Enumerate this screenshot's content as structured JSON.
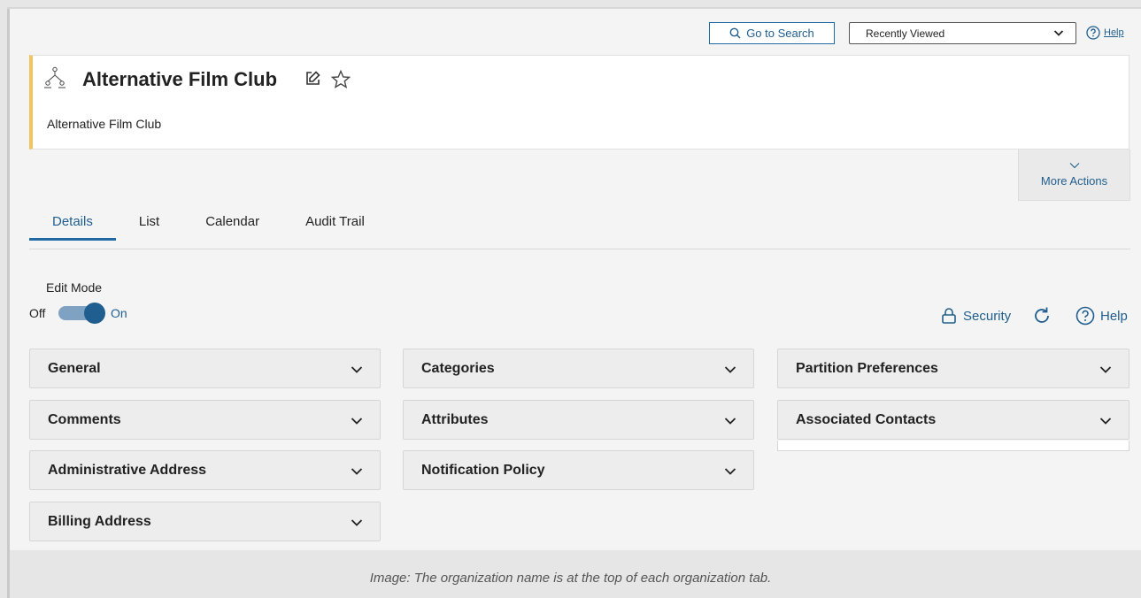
{
  "topbar": {
    "search_label": "Go to Search",
    "recent_value": "Recently Viewed",
    "help_label": "Help"
  },
  "header": {
    "title": "Alternative Film Club",
    "subtitle": "Alternative Film Club",
    "accent_color": "#f0c560"
  },
  "more_actions_label": "More Actions",
  "tabs": [
    {
      "label": "Details",
      "active": true
    },
    {
      "label": "List"
    },
    {
      "label": "Calendar"
    },
    {
      "label": "Audit Trail"
    }
  ],
  "edit_mode": {
    "label": "Edit Mode",
    "off_label": "Off",
    "on_label": "On",
    "state": "on"
  },
  "actions": {
    "security_label": "Security",
    "help_label": "Help"
  },
  "panels": {
    "col1": [
      "General",
      "Comments",
      "Administrative Address",
      "Billing Address"
    ],
    "col2": [
      "Categories",
      "Attributes",
      "Notification Policy"
    ],
    "col3": [
      "Partition Preferences",
      "Associated Contacts"
    ]
  },
  "caption": "Image: The organization name is at the top of each organization tab.",
  "colors": {
    "link_blue": "#1f5e8f",
    "panel_bg": "#ededed"
  }
}
